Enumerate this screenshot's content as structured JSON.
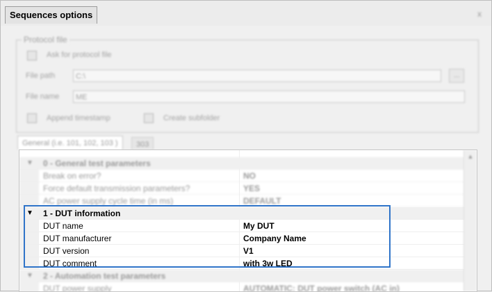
{
  "window": {
    "title": "Sequences options",
    "close_glyph": "x"
  },
  "protocol_file": {
    "legend": "Protocol file",
    "ask_label": "Ask for protocol file",
    "file_path_label": "File path",
    "file_path_value": "C:\\",
    "browse_label": "...",
    "file_name_label": "File name",
    "file_name_value": "ME",
    "append_timestamp_label": "Append timestamp",
    "create_subfolder_label": "Create subfolder"
  },
  "tabs": [
    {
      "label": "General (i.e. 101, 102, 103 )"
    },
    {
      "label": "303"
    }
  ],
  "grid": {
    "sections": [
      {
        "label": "0 - General test parameters",
        "rows": [
          {
            "name": "Break on error?",
            "value": "NO"
          },
          {
            "name": "Force default transmission parameters?",
            "value": "YES"
          },
          {
            "name": "AC power supply cycle time (in ms)",
            "value": "DEFAULT"
          }
        ]
      },
      {
        "label": "1 - DUT information",
        "rows": [
          {
            "name": "DUT name",
            "value": "My DUT"
          },
          {
            "name": "DUT manufacturer",
            "value": "Company Name"
          },
          {
            "name": "DUT version",
            "value": "V1"
          },
          {
            "name": "DUT comment",
            "value": "with 3w LED"
          }
        ]
      },
      {
        "label": "2 - Automation test parameters",
        "rows": [
          {
            "name": "DUT power supply",
            "value": "AUTOMATIC: DUT power switch (AC in)"
          }
        ]
      }
    ]
  },
  "colors": {
    "highlight_border": "#2f74c9",
    "window_bg": "#f0f0f0"
  }
}
